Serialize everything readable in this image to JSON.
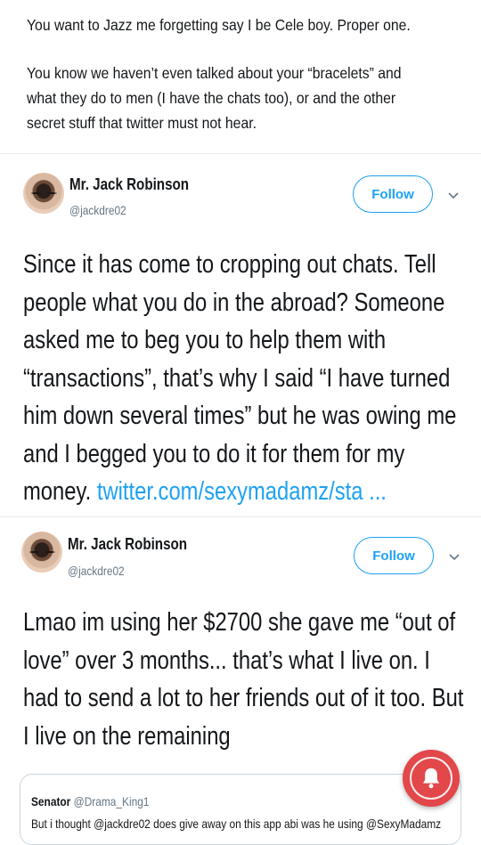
{
  "intro": {
    "p1": "You want to Jazz me forgetting say I be Cele boy. Proper one.",
    "p2": "You know we haven’t even talked about your “bracelets” and what they do to men (I have the chats too), or and the other secret stuff that twitter must not hear."
  },
  "tweets": [
    {
      "name": "Mr. Jack Robinson",
      "handle": "@jackdre02",
      "follow_label": "Follow",
      "text": "Since it has come to cropping out chats. Tell people what you do in the abroad? Someone asked me to beg you to help them with “transactions”, that’s why I said “I have turned him down several times” but he was owing me and I begged you to do it for them for my money. ",
      "link": "twitter.com/sexymadamz/sta ..."
    },
    {
      "name": "Mr. Jack Robinson",
      "handle": "@jackdre02",
      "follow_label": "Follow",
      "text": "Lmao im using her $2700 she gave me  “out of love” over 3 months... that’s what I live on. I had to send a lot to her friends out of it too. But I live on the remaining"
    }
  ],
  "quote": {
    "name": "Senator",
    "handle": "@Drama_King1",
    "text": "But i thought @jackdre02 does give away on this app abi was he using @SexyMadamz"
  },
  "icons": {
    "chevron": "chevron-down-icon",
    "bell": "notification-bell-icon"
  },
  "colors": {
    "accent": "#1da1f2",
    "bell": "#e2474a"
  }
}
